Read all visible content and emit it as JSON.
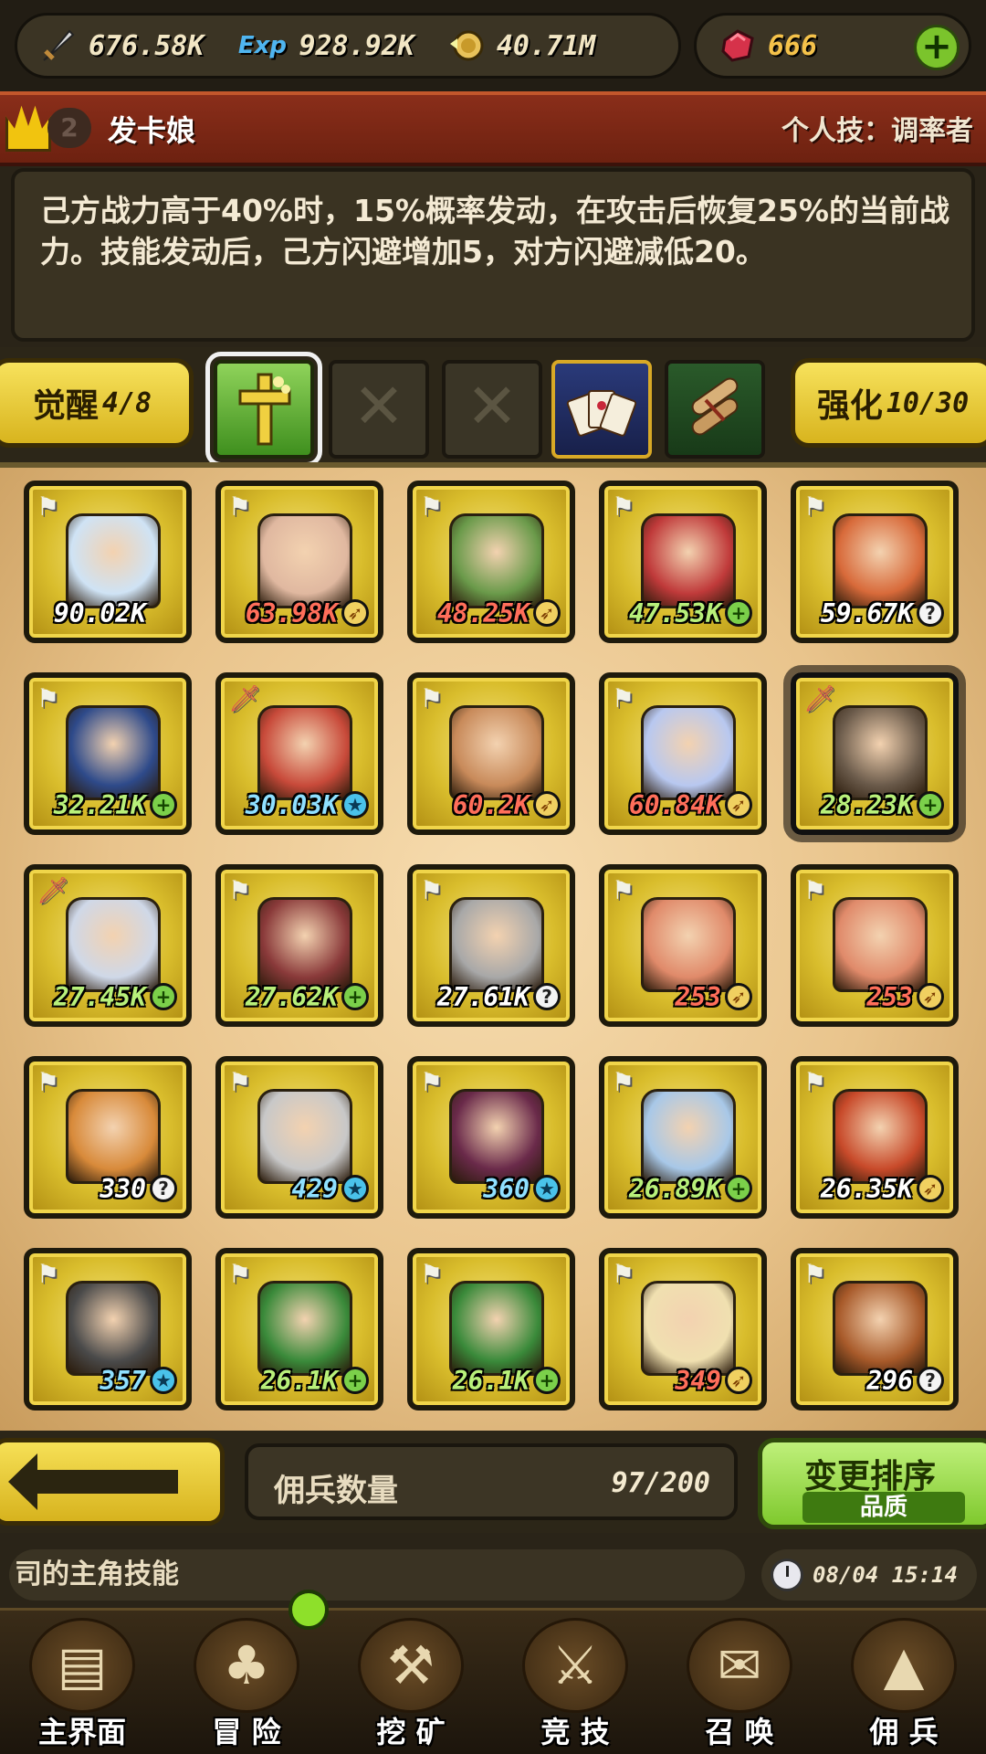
{
  "resources": {
    "attack": "676.58K",
    "exp_label": "Exp",
    "exp": "928.92K",
    "gold": "40.71M",
    "gems": "666"
  },
  "hero": {
    "level": "2",
    "name": "发卡娘",
    "skill": "个人技：调率者",
    "description": "己方战力高于40%时，15%概率发动，在攻击后恢复25%的当前战力。技能发动后，己方闪避增加5，对方闪避减低20。"
  },
  "slots": {
    "awaken_label": "觉醒",
    "awaken_value": "4/8",
    "enhance_label": "强化",
    "enhance_value": "10/30"
  },
  "cards": [
    {
      "value": "90.02K",
      "tag": "flag",
      "type": "none",
      "color": "white",
      "hue": "#cfe3f5"
    },
    {
      "value": "63.98K",
      "tag": "flag",
      "type": "skill",
      "color": "red",
      "hue": "#e0b8a0"
    },
    {
      "value": "48.25K",
      "tag": "flag",
      "type": "skill",
      "color": "red",
      "hue": "#6a9a4a"
    },
    {
      "value": "47.53K",
      "tag": "flag",
      "type": "heal",
      "color": "green",
      "hue": "#c03a3a"
    },
    {
      "value": "59.67K",
      "tag": "flag",
      "type": "unknown",
      "color": "white",
      "hue": "#d86a3a"
    },
    {
      "value": "32.21K",
      "tag": "flag",
      "type": "heal",
      "color": "green",
      "hue": "#2e4a8a"
    },
    {
      "value": "30.03K",
      "tag": "sword",
      "type": "star",
      "color": "blue",
      "hue": "#c84a3a"
    },
    {
      "value": "60.2K",
      "tag": "flag",
      "type": "skill",
      "color": "red",
      "hue": "#c88a5a"
    },
    {
      "value": "60.84K",
      "tag": "flag",
      "type": "skill",
      "color": "red",
      "hue": "#b8c8f0"
    },
    {
      "value": "28.23K",
      "tag": "sword",
      "type": "heal",
      "color": "green",
      "hue": "#6a5a4a"
    },
    {
      "value": "27.45K",
      "tag": "sword",
      "type": "heal",
      "color": "green",
      "hue": "#cfd8e8"
    },
    {
      "value": "27.62K",
      "tag": "flag",
      "type": "heal",
      "color": "green",
      "hue": "#8a3a3a"
    },
    {
      "value": "27.61K",
      "tag": "flag",
      "type": "unknown",
      "color": "white",
      "hue": "#a8a8a8"
    },
    {
      "value": "253",
      "tag": "flag",
      "type": "skill",
      "color": "red",
      "hue": "#e08a6a"
    },
    {
      "value": "253",
      "tag": "flag",
      "type": "skill",
      "color": "red",
      "hue": "#e08a6a"
    },
    {
      "value": "330",
      "tag": "flag",
      "type": "unknown",
      "color": "white",
      "hue": "#d88a3a"
    },
    {
      "value": "429",
      "tag": "flag",
      "type": "star",
      "color": "blue",
      "hue": "#c8c8c8"
    },
    {
      "value": "360",
      "tag": "flag",
      "type": "star",
      "color": "blue",
      "hue": "#6a2a4a"
    },
    {
      "value": "26.89K",
      "tag": "flag",
      "type": "heal",
      "color": "green",
      "hue": "#a8c8e8"
    },
    {
      "value": "26.35K",
      "tag": "flag",
      "type": "skill",
      "color": "white",
      "hue": "#c84a2a"
    },
    {
      "value": "357",
      "tag": "flag",
      "type": "star",
      "color": "blue",
      "hue": "#4a4a4a"
    },
    {
      "value": "26.1K",
      "tag": "flag",
      "type": "heal",
      "color": "green",
      "hue": "#3a8a3a"
    },
    {
      "value": "26.1K",
      "tag": "flag",
      "type": "heal",
      "color": "green",
      "hue": "#3a8a3a"
    },
    {
      "value": "349",
      "tag": "flag",
      "type": "skill",
      "color": "red",
      "hue": "#f0e0b0"
    },
    {
      "value": "296",
      "tag": "flag",
      "type": "unknown",
      "color": "white",
      "hue": "#a85a2a"
    }
  ],
  "controls": {
    "count_label": "佣兵数量",
    "count_value": "97/200",
    "sort_title": "变更排序",
    "sort_sub": "品质"
  },
  "ticker": {
    "text": "司的主角技能",
    "time": "08/04 15:14"
  },
  "nav": [
    {
      "label": "主界面",
      "icon": "map-icon"
    },
    {
      "label": "冒 险",
      "icon": "island-icon"
    },
    {
      "label": "挖 矿",
      "icon": "pickaxe-icon"
    },
    {
      "label": "竞 技",
      "icon": "swords-icon"
    },
    {
      "label": "召 唤",
      "icon": "scroll-icon"
    },
    {
      "label": "佣 兵",
      "icon": "tent-icon"
    }
  ]
}
